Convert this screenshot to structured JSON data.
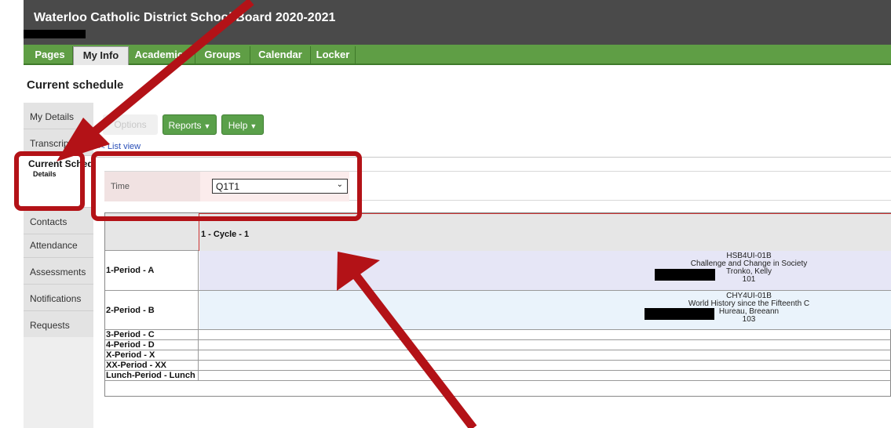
{
  "app": {
    "title": "Waterloo Catholic District School Board 2020-2021"
  },
  "tabs": [
    "Pages",
    "My Info",
    "Academics",
    "Groups",
    "Calendar",
    "Locker"
  ],
  "page": {
    "title": "Current schedule"
  },
  "sidebar": {
    "items": [
      {
        "label": "My Details"
      },
      {
        "label": "Transcript"
      },
      {
        "label": "Current Schedule",
        "sub": "Details",
        "active": true
      },
      {
        "label": "Contacts"
      },
      {
        "label": "Attendance"
      },
      {
        "label": "Assessments"
      },
      {
        "label": "Notifications"
      },
      {
        "label": "Requests"
      }
    ]
  },
  "toolbar": {
    "options": "Options",
    "reports": "Reports",
    "help": "Help"
  },
  "list_view_link": "<< List view",
  "filter": {
    "label": "Time",
    "value": "Q1T1"
  },
  "schedule": {
    "cycle_header": "1 - Cycle - 1",
    "rows": [
      {
        "period": "1-Period - A",
        "course": {
          "code": "HSB4UI-01B",
          "name": "Challenge and Change in Society",
          "teacher": "Tronko, Kelly",
          "room": "101"
        }
      },
      {
        "period": "2-Period - B",
        "course": {
          "code": "CHY4UI-01B",
          "name": "World History since the Fifteenth C",
          "teacher": "Hureau, Breeann",
          "room": "103"
        }
      },
      {
        "period": "3-Period - C"
      },
      {
        "period": "4-Period - D"
      },
      {
        "period": "X-Period - X"
      },
      {
        "period": "XX-Period - XX"
      },
      {
        "period": "Lunch-Period - Lunch"
      }
    ]
  },
  "colors": {
    "header_bg": "#4a4a4a",
    "tab_bar": "#5f9e45",
    "annotation_red": "#b31217",
    "row_a_bg": "#e6e6f6",
    "row_b_bg": "#eaf3fb"
  },
  "icons": [
    "chevron-down-icon",
    "annotation-arrow-icon"
  ]
}
